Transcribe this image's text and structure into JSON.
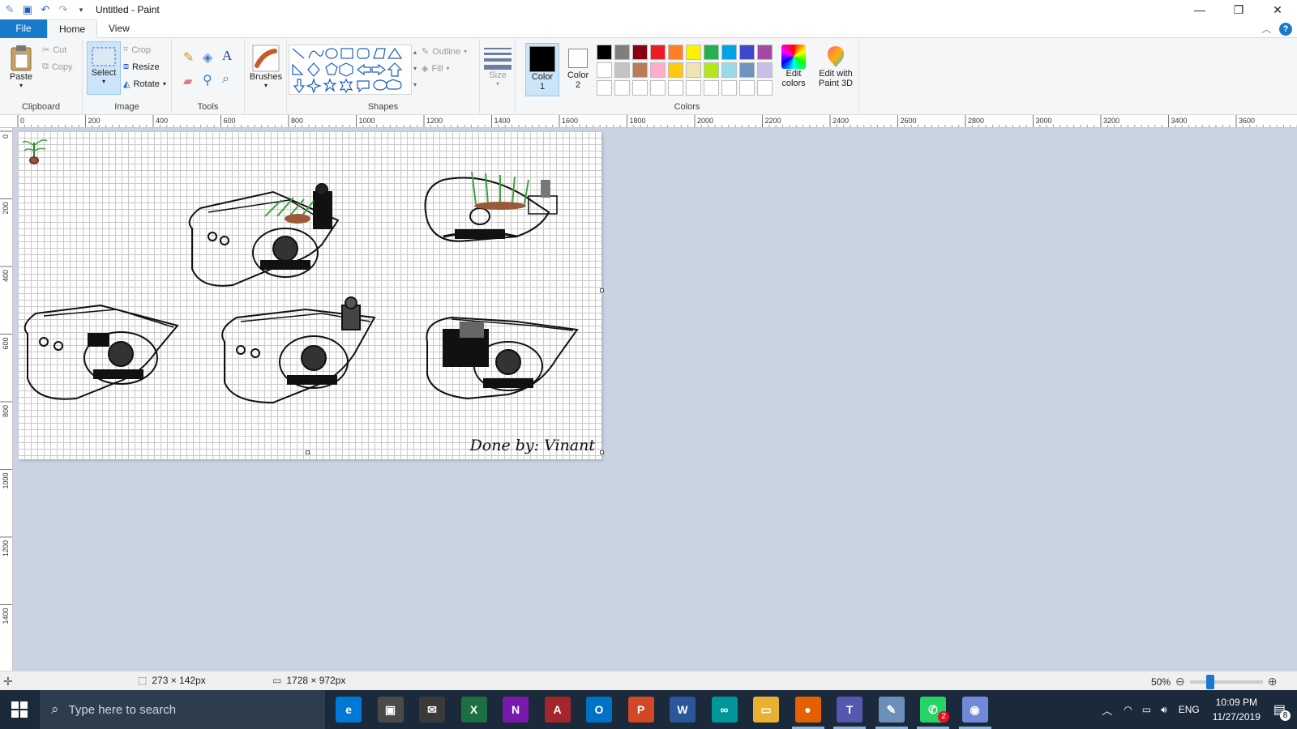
{
  "window": {
    "title": "Untitled - Paint"
  },
  "tabs": [
    "File",
    "Home",
    "View"
  ],
  "ribbon": {
    "clipboard": {
      "label": "Clipboard",
      "paste": "Paste",
      "cut": "Cut",
      "copy": "Copy"
    },
    "image": {
      "label": "Image",
      "select": "Select",
      "crop": "Crop",
      "resize": "Resize",
      "rotate": "Rotate"
    },
    "tools": {
      "label": "Tools"
    },
    "brushes": {
      "label": "Brushes"
    },
    "shapes": {
      "label": "Shapes",
      "outline": "Outline",
      "fill": "Fill"
    },
    "size": {
      "label": "Size"
    },
    "colors": {
      "label": "Colors",
      "color1": "Color",
      "color1_num": "1",
      "color2": "Color",
      "color2_num": "2",
      "edit": "Edit",
      "edit2": "colors",
      "paint3d": "Edit with",
      "paint3d2": "Paint 3D",
      "selected_color1": "#000000",
      "selected_color2": "#ffffff",
      "palette_row1": [
        "#000000",
        "#7f7f7f",
        "#880015",
        "#ed1c24",
        "#ff7f27",
        "#fff200",
        "#22b14c",
        "#00a2e8",
        "#3f48cc",
        "#a349a4"
      ],
      "palette_row2": [
        "#ffffff",
        "#c3c3c3",
        "#b97a57",
        "#ffaec9",
        "#ffc90e",
        "#efe4b0",
        "#b5e61d",
        "#99d9ea",
        "#7092be",
        "#c8bfe7"
      ],
      "palette_row3": [
        "#ffffff",
        "#ffffff",
        "#ffffff",
        "#ffffff",
        "#ffffff",
        "#ffffff",
        "#ffffff",
        "#ffffff",
        "#ffffff",
        "#ffffff"
      ]
    }
  },
  "ruler_h": [
    "0",
    "200",
    "400",
    "600",
    "800",
    "1000",
    "1200",
    "1400",
    "1600",
    "1800",
    "2000",
    "2200",
    "2400",
    "2600",
    "2800",
    "3000",
    "3200",
    "3400",
    "3600"
  ],
  "ruler_v": [
    "0",
    "200",
    "400",
    "600",
    "800",
    "1000",
    "1200",
    "1400"
  ],
  "canvas": {
    "signature": "Done by: Vinant"
  },
  "status": {
    "selection": "273 × 142px",
    "image_size": "1728 × 972px",
    "zoom": "50%",
    "zoom_fraction": 0.5
  },
  "taskbar": {
    "search_placeholder": "Type here to search",
    "language": "ENG",
    "time": "10:09 PM",
    "date": "11/27/2019",
    "notifications": "8",
    "apps": [
      {
        "name": "edge",
        "letter": "e",
        "color": "#0078d7"
      },
      {
        "name": "store",
        "letter": "▣",
        "color": "#4a4a4a"
      },
      {
        "name": "mail",
        "letter": "✉",
        "color": "#3a3a3a"
      },
      {
        "name": "excel",
        "letter": "X",
        "color": "#1d6f42"
      },
      {
        "name": "onenote",
        "letter": "N",
        "color": "#7719aa"
      },
      {
        "name": "access",
        "letter": "A",
        "color": "#a4262c"
      },
      {
        "name": "outlook",
        "letter": "O",
        "color": "#0072c6"
      },
      {
        "name": "powerpoint",
        "letter": "P",
        "color": "#d24726"
      },
      {
        "name": "word",
        "letter": "W",
        "color": "#2b579a"
      },
      {
        "name": "arduino",
        "letter": "∞",
        "color": "#00979c"
      },
      {
        "name": "explorer",
        "letter": "▭",
        "color": "#e8b131"
      },
      {
        "name": "firefox",
        "letter": "●",
        "color": "#e66000"
      },
      {
        "name": "teams",
        "letter": "T",
        "color": "#5558af"
      },
      {
        "name": "paint",
        "letter": "✎",
        "color": "#6b8fb8"
      },
      {
        "name": "whatsapp",
        "letter": "✆",
        "color": "#25d366"
      },
      {
        "name": "discord",
        "letter": "◉",
        "color": "#7289da"
      }
    ],
    "whatsapp_badge": "2"
  }
}
